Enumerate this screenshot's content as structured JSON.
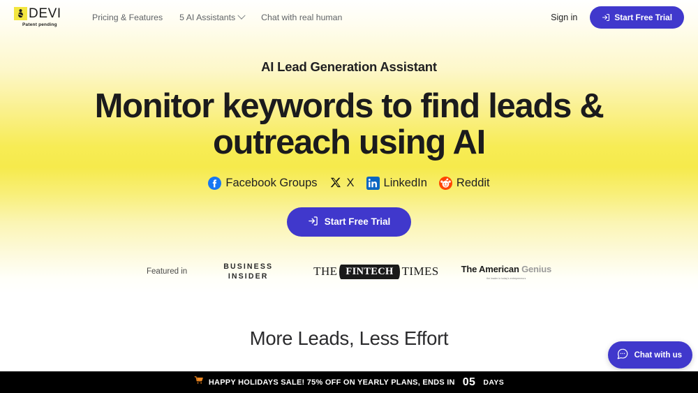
{
  "header": {
    "logo": {
      "mark_icon": "devi-logo-icon",
      "wordmark": "DEVI",
      "tagline": "Patent pending"
    },
    "nav": [
      {
        "label": "Pricing & Features",
        "has_dropdown": false
      },
      {
        "label": "5 AI Assistants",
        "has_dropdown": true
      },
      {
        "label": "Chat with real human",
        "has_dropdown": false
      }
    ],
    "sign_in_label": "Sign in",
    "cta_label": "Start Free Trial",
    "cta_icon": "login-icon",
    "cta_color": "#4038cc"
  },
  "hero": {
    "eyebrow": "AI Lead Generation Assistant",
    "title": "Monitor keywords to find leads & outreach using AI",
    "platforms": [
      {
        "icon": "facebook-icon",
        "label": "Facebook Groups",
        "color": "#1877F2"
      },
      {
        "icon": "x-icon",
        "label": "X",
        "color": "#000000"
      },
      {
        "icon": "linkedin-icon",
        "label": "LinkedIn",
        "color": "#0A66C2"
      },
      {
        "icon": "reddit-icon",
        "label": "Reddit",
        "color": "#FF4500"
      }
    ],
    "cta_label": "Start Free Trial",
    "cta_icon": "login-icon",
    "gradient_peak_color": "#f6ea4c"
  },
  "featured": {
    "label": "Featured in",
    "logos": [
      {
        "name": "business-insider",
        "line1": "BUSINESS",
        "line2": "INSIDER"
      },
      {
        "name": "the-fintech-times",
        "prefix": "THE",
        "badge": "FINTECH",
        "suffix": "TIMES"
      },
      {
        "name": "the-american-genius",
        "line1_a": "The American",
        "line1_b": "Genius",
        "line2": "the leader in today's entrepreneurs"
      }
    ]
  },
  "section2": {
    "title": "More Leads, Less Effort"
  },
  "sale_banner": {
    "icon": "shopping-cart-icon",
    "text": "HAPPY HOLIDAYS SALE! 75% OFF ON YEARLY PLANS, ENDS IN",
    "count": "05",
    "unit": "DAYS",
    "background": "#000000"
  },
  "chat_widget": {
    "icon": "chat-bubble-icon",
    "label": "Chat with us",
    "color": "#4038cc"
  }
}
